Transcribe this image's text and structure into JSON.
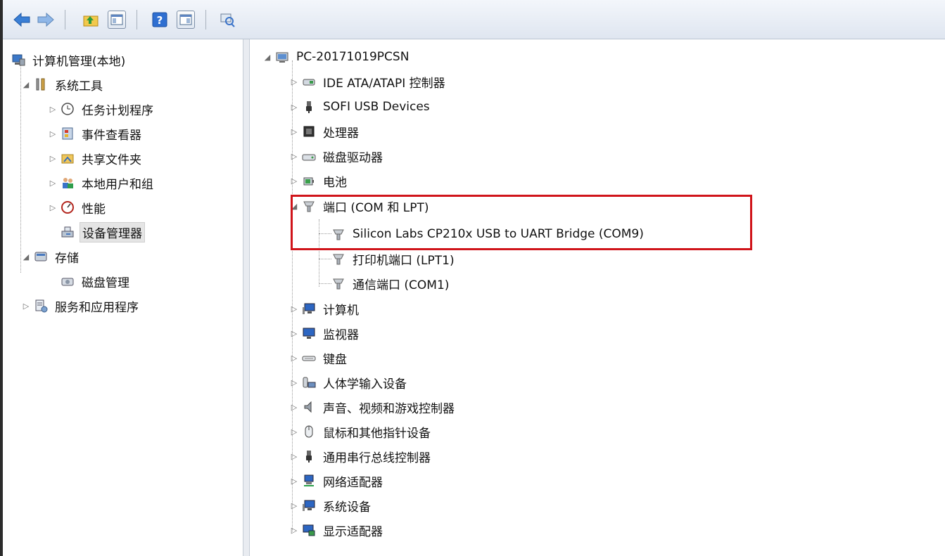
{
  "colors": {
    "highlight_box": "#d0141a",
    "selection_bg": "#e5e5e5"
  },
  "toolbar": {
    "buttons": [
      {
        "icon": "back-arrow-icon"
      },
      {
        "icon": "forward-arrow-icon"
      },
      {
        "icon": "up-folder-icon"
      },
      {
        "icon": "show-hide-console-tree-icon"
      },
      {
        "icon": "help-icon"
      },
      {
        "icon": "show-hide-action-pane-icon"
      },
      {
        "icon": "scan-hardware-changes-icon"
      }
    ]
  },
  "left_tree": {
    "root": "计算机管理(本地)",
    "system_tools": "系统工具",
    "task_scheduler": "任务计划程序",
    "event_viewer": "事件查看器",
    "shared_folders": "共享文件夹",
    "local_users": "本地用户和组",
    "performance": "性能",
    "device_manager": "设备管理器",
    "storage": "存储",
    "disk_management": "磁盘管理",
    "services_apps": "服务和应用程序"
  },
  "device_tree": {
    "computer_name": "PC-20171019PCSN",
    "categories": [
      {
        "label": "IDE ATA/ATAPI 控制器",
        "icon": "ide-controller-icon"
      },
      {
        "label": "SOFI USB Devices",
        "icon": "usb-plug-icon"
      },
      {
        "label": "处理器",
        "icon": "processor-icon"
      },
      {
        "label": "磁盘驱动器",
        "icon": "disk-drive-icon"
      },
      {
        "label": "电池",
        "icon": "battery-icon"
      },
      {
        "label": "端口 (COM 和 LPT)",
        "icon": "port-icon"
      },
      {
        "label": "计算机",
        "icon": "computer-icon"
      },
      {
        "label": "监视器",
        "icon": "monitor-icon"
      },
      {
        "label": "键盘",
        "icon": "keyboard-icon"
      },
      {
        "label": "人体学输入设备",
        "icon": "hid-icon"
      },
      {
        "label": "声音、视频和游戏控制器",
        "icon": "speaker-icon"
      },
      {
        "label": "鼠标和其他指针设备",
        "icon": "mouse-icon"
      },
      {
        "label": "通用串行总线控制器",
        "icon": "usb-plug-icon"
      },
      {
        "label": "网络适配器",
        "icon": "network-adapter-icon"
      },
      {
        "label": "系统设备",
        "icon": "system-device-icon"
      },
      {
        "label": "显示适配器",
        "icon": "display-adapter-icon"
      }
    ],
    "ports": [
      "Silicon Labs CP210x USB to UART Bridge (COM9)",
      "打印机端口 (LPT1)",
      "通信端口 (COM1)"
    ]
  }
}
